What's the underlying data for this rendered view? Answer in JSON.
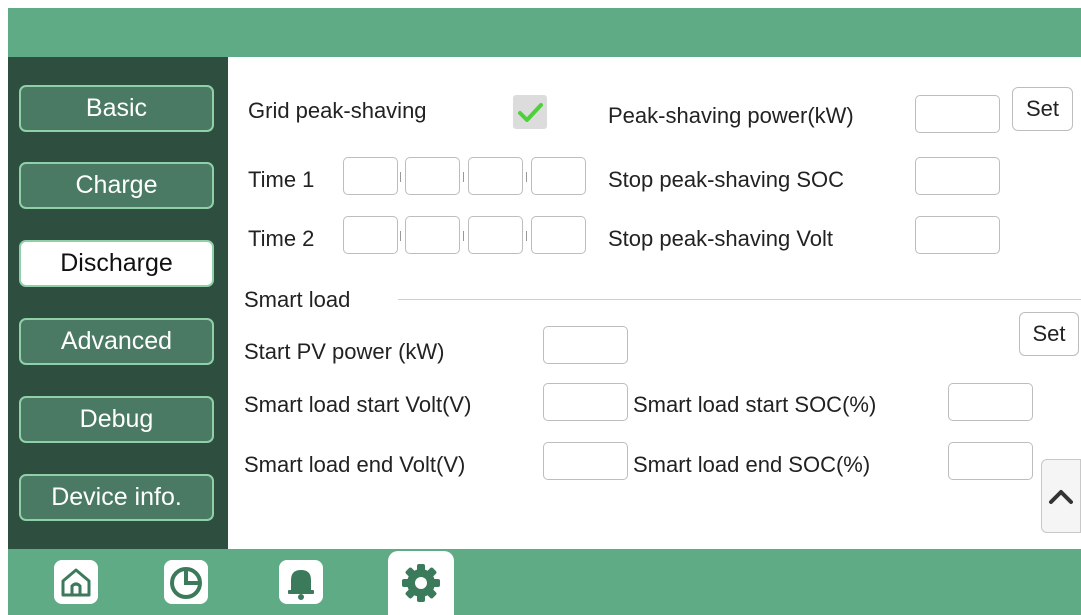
{
  "sidebar": {
    "items": [
      {
        "label": "Basic"
      },
      {
        "label": "Charge"
      },
      {
        "label": "Discharge"
      },
      {
        "label": "Advanced"
      },
      {
        "label": "Debug"
      },
      {
        "label": "Device info."
      }
    ],
    "active": "Discharge"
  },
  "discharge": {
    "grid_peak_shaving_label": "Grid peak-shaving",
    "grid_peak_shaving_checked": true,
    "peak_shaving_power_label": "Peak-shaving power(kW)",
    "set_label": "Set",
    "time1_label": "Time 1",
    "time2_label": "Time 2",
    "stop_soc_label": "Stop peak-shaving SOC",
    "stop_volt_label": "Stop peak-shaving Volt"
  },
  "smart_load": {
    "section_title": "Smart load",
    "start_pv_power_label": "Start PV power (kW)",
    "set_label": "Set",
    "start_volt_label": "Smart load start Volt(V)",
    "start_soc_label": "Smart load start SOC(%)",
    "end_volt_label": "Smart load end Volt(V)",
    "end_soc_label": "Smart load end SOC(%)"
  },
  "bottom_nav": {
    "icons": [
      "home-icon",
      "pie-chart-icon",
      "bell-icon",
      "gear-icon"
    ],
    "active": "gear-icon"
  },
  "colors": {
    "header_green": "#5fab85",
    "sidebar_dark": "#2e4f3f",
    "nav_button": "#4a7a63",
    "check_green": "#4cd137"
  }
}
